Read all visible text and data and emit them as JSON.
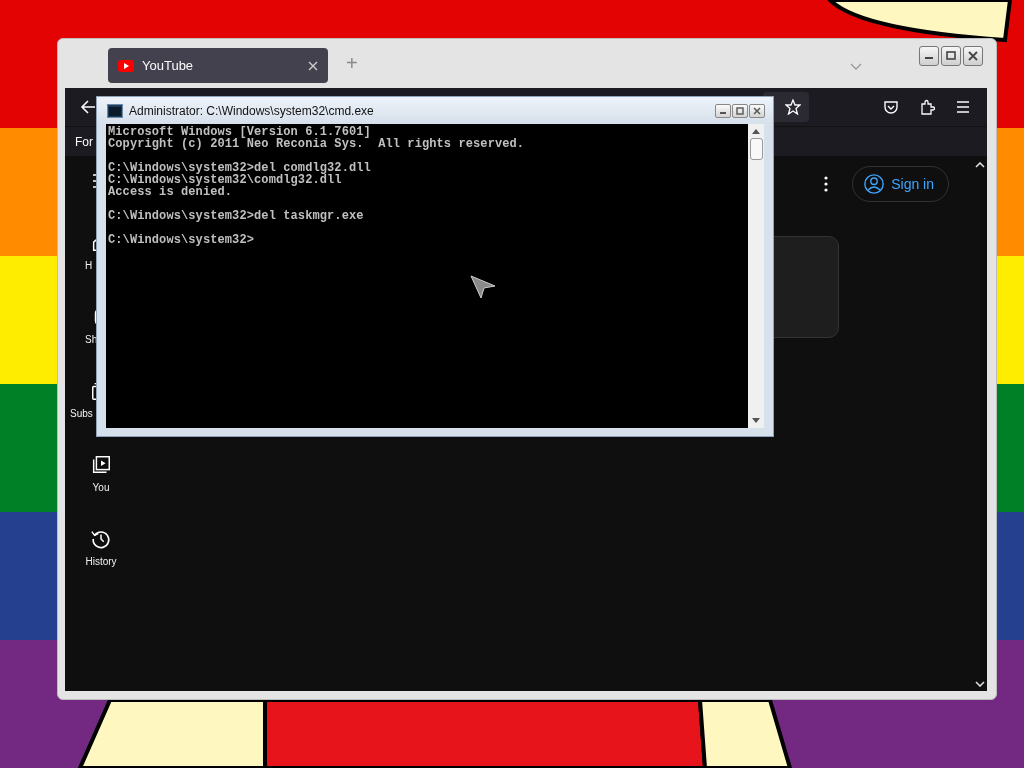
{
  "browser": {
    "tabs": [
      {
        "title": "YouTube",
        "selected": true
      }
    ],
    "new_tab": "+",
    "bookmarks_bar": {
      "text": "For"
    },
    "sidebar": {
      "items": [
        {
          "label": "H",
          "cut": true
        },
        {
          "label": "Sh",
          "cut": true
        },
        {
          "label": "Subs",
          "cut": true
        },
        {
          "label": "You",
          "cut": false
        },
        {
          "label": "History",
          "cut": false
        }
      ]
    },
    "sign_in": "Sign in"
  },
  "console_window": {
    "title": "Administrator: C:\\Windows\\system32\\cmd.exe",
    "blocks": [
      [
        "Microsoft Windows [Version 6.1.7601]",
        "Copyright (c) 2011 Neo Reconia Sys.  All rights reserved."
      ],
      [
        "C:\\Windows\\system32>del comdlg32.dll",
        "C:\\Windows\\system32\\comdlg32.dll",
        "Access is denied."
      ],
      [
        "C:\\Windows\\system32>del taskmgr.exe"
      ],
      [
        "C:\\Windows\\system32>"
      ]
    ]
  }
}
